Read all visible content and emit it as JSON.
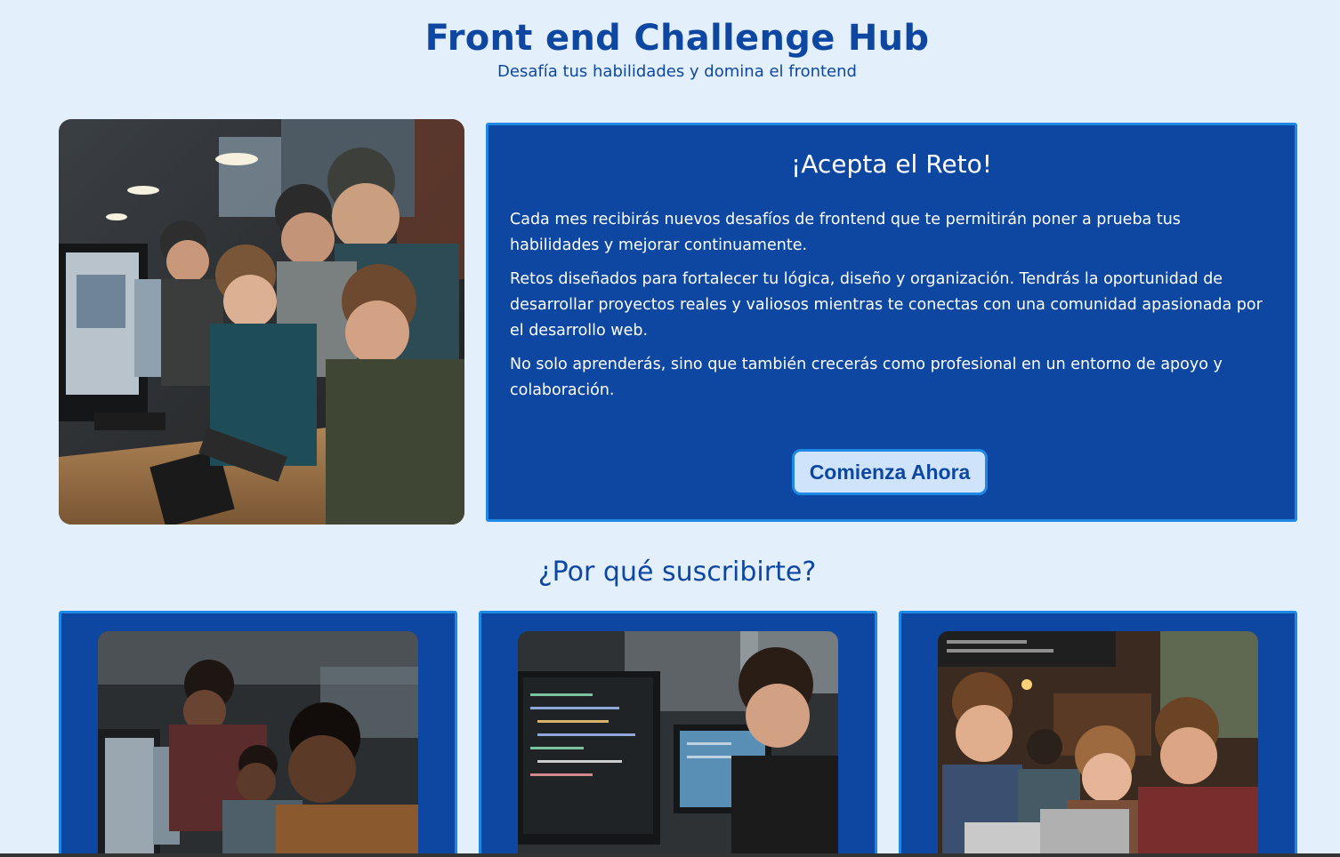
{
  "header": {
    "title": "Front end Challenge Hub",
    "subtitle": "Desafía tus habilidades y domina el frontend"
  },
  "hero": {
    "image_alt": "Grupo de jóvenes programando frente a computadoras",
    "card": {
      "heading": "¡Acepta el Reto!",
      "paragraphs": [
        "Cada mes recibirás nuevos desafíos de frontend que te permitirán poner a prueba tus habilidades y mejorar continuamente.",
        "Retos diseñados para fortalecer tu lógica, diseño y organización. Tendrás la oportunidad de desarrollar proyectos reales y valiosos mientras te conectas con una comunidad apasionada por el desarrollo web.",
        "No solo aprenderás, sino que también crecerás como profesional en un entorno de apoyo y colaboración."
      ],
      "cta_label": "Comienza Ahora"
    }
  },
  "benefits": {
    "heading": "¿Por qué suscribirte?",
    "cards": [
      {
        "image": "photo-developers-team"
      },
      {
        "image": "photo-developer-coding"
      },
      {
        "image": "photo-community-cafe"
      }
    ]
  },
  "colors": {
    "background": "#e3f0fc",
    "primary": "#0d47a1",
    "accent": "#1e88e5",
    "button_bg": "#cfe4fb"
  }
}
